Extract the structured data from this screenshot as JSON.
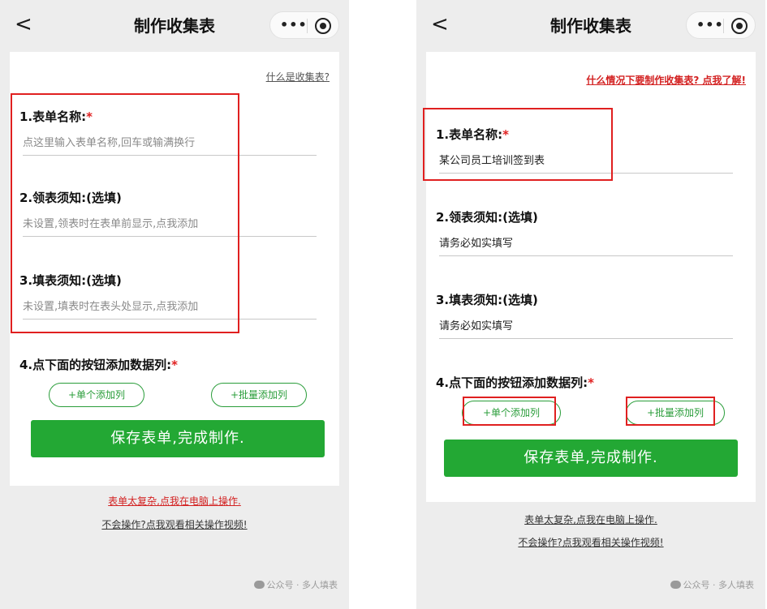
{
  "nav": {
    "back_glyph": "<",
    "title": "制作收集表",
    "menu_glyph": "•••"
  },
  "left": {
    "help_link": "什么是收集表?",
    "fields": [
      {
        "label": "1.表单名称:",
        "required": "*",
        "value": "点这里输入表单名称,回车或输满换行"
      },
      {
        "label": "2.领表须知:(选填)",
        "value": "未设置,领表时在表单前显示,点我添加"
      },
      {
        "label": "3.填表须知:(选填)",
        "value": "未设置,填表时在表头处显示,点我添加"
      },
      {
        "label": "4.点下面的按钮添加数据列:",
        "required": "*"
      }
    ]
  },
  "right": {
    "help_link": "什么情况下要制作收集表? 点我了解!",
    "fields": [
      {
        "label": "1.表单名称:",
        "required": "*",
        "value": "某公司员工培训签到表"
      },
      {
        "label": "2.领表须知:(选填)",
        "value": "请务必如实填写"
      },
      {
        "label": "3.填表须知:(选填)",
        "value": "请务必如实填写"
      },
      {
        "label": "4.点下面的按钮添加数据列:",
        "required": "*"
      }
    ]
  },
  "buttons": {
    "add_single": "+单个添加列",
    "add_batch": "+批量添加列",
    "save": "保存表单,完成制作."
  },
  "footer": {
    "complex_link": "表单太复杂,点我在电脑上操作.",
    "video_link": "不会操作?点我观看相关操作视频!",
    "watermark": "公众号 · 多人填表"
  },
  "colors": {
    "accent_green": "#23a834",
    "highlight_red": "#e02020",
    "page_bg": "#ededed"
  }
}
